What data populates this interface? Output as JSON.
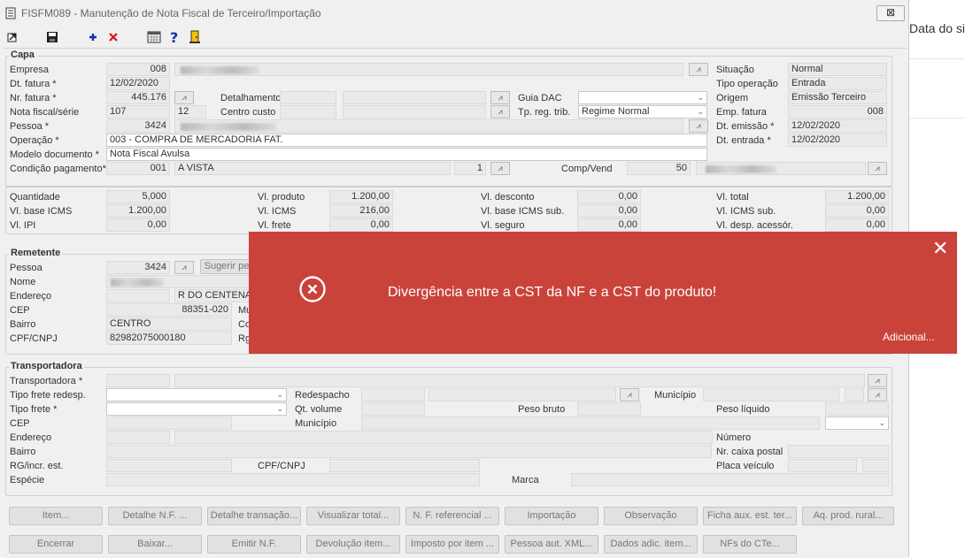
{
  "window": {
    "title": "FISFM089 - Manutenção de Nota Fiscal de Terceiro/Importação",
    "close_glyph": "⊠"
  },
  "toolbar": {
    "icons": [
      "exit-icon",
      "save-icon",
      "add-icon",
      "delete-icon",
      "calendar-icon",
      "help-icon",
      "door-icon"
    ]
  },
  "background_page": {
    "text": "Data do si"
  },
  "capa": {
    "legend": "Capa",
    "empresa": {
      "label": "Empresa",
      "code": "008"
    },
    "dt_fatura": {
      "label": "Dt. fatura *",
      "value": "12/02/2020"
    },
    "nr_fatura": {
      "label": "Nr. fatura *",
      "value": "445.176"
    },
    "detalhamento": {
      "label": "Detalhamento"
    },
    "guia_dac": {
      "label": "Guia DAC",
      "value": ""
    },
    "nota_fiscal": {
      "label": "Nota fiscal/série",
      "number": "107",
      "serie": "12"
    },
    "centro_custo": {
      "label": "Centro custo"
    },
    "tp_reg_trib": {
      "label": "Tp. reg. trib.",
      "value": "Regime Normal"
    },
    "pessoa": {
      "label": "Pessoa *",
      "code": "3424"
    },
    "operacao": {
      "label": "Operação *",
      "value": "003 - COMPRA DE MERCADORIA FAT."
    },
    "modelo": {
      "label": "Modelo documento *",
      "value": "Nota Fiscal Avulsa"
    },
    "condicao": {
      "label": "Condição pagamento*",
      "code": "001",
      "desc": "A VISTA",
      "parcelas": "1"
    },
    "comp_vend": {
      "label": "Comp/Vend",
      "code": "50"
    },
    "situacao": {
      "label": "Situação",
      "value": "Normal"
    },
    "tipo_operacao": {
      "label": "Tipo operação",
      "value": "Entrada"
    },
    "origem": {
      "label": "Origem",
      "value": "Emissão Terceiro"
    },
    "emp_fatura": {
      "label": "Emp. fatura",
      "value": "008"
    },
    "dt_emissao": {
      "label": "Dt. emissão *",
      "value": "12/02/2020"
    },
    "dt_entrada": {
      "label": "Dt. entrada *",
      "value": "12/02/2020"
    }
  },
  "totais": {
    "quantidade": {
      "label": "Quantidade",
      "value": "5,000"
    },
    "vl_base_icms": {
      "label": "Vl. base ICMS",
      "value": "1.200,00"
    },
    "vl_ipi": {
      "label": "Vl. IPI",
      "value": "0,00"
    },
    "vl_produto": {
      "label": "Vl. produto",
      "value": "1.200,00"
    },
    "vl_icms": {
      "label": "Vl. ICMS",
      "value": "216,00"
    },
    "vl_frete": {
      "label": "Vl. frete",
      "value": "0,00"
    },
    "vl_desconto": {
      "label": "Vl. desconto",
      "value": "0,00"
    },
    "vl_base_icms_sub": {
      "label": "Vl. base ICMS sub.",
      "value": "0,00"
    },
    "vl_seguro": {
      "label": "Vl. seguro",
      "value": "0,00"
    },
    "vl_total": {
      "label": "Vl. total",
      "value": "1.200,00"
    },
    "vl_icms_sub": {
      "label": "Vl. ICMS sub.",
      "value": "0,00"
    },
    "vl_desp_acessor": {
      "label": "Vl. desp. acessór.",
      "value": "0,00"
    }
  },
  "remetente": {
    "legend": "Remetente",
    "pessoa": {
      "label": "Pessoa",
      "code": "3424"
    },
    "sugerir_button": "Sugerir pe",
    "nome": {
      "label": "Nome"
    },
    "endereco": {
      "label": "Endereço",
      "value": "R DO CENTENAR"
    },
    "cep": {
      "label": "CEP",
      "value": "88351-020"
    },
    "bairro": {
      "label": "Bairro",
      "value": "CENTRO"
    },
    "cpf_cnpj": {
      "label": "CPF/CNPJ",
      "value": "82982075000180"
    },
    "mu_label": "Mu",
    "co_label": "Co",
    "rg_label": "Rg"
  },
  "transportadora": {
    "legend": "Transportadora",
    "transportadora": {
      "label": "Transportadora *"
    },
    "tipo_frete_redesp": {
      "label": "Tipo frete redesp.",
      "value": ""
    },
    "redespacho": {
      "label": "Redespacho"
    },
    "municipio1": {
      "label": "Município"
    },
    "tipo_frete": {
      "label": "Tipo frete *",
      "value": ""
    },
    "qt_volume": {
      "label": "Qt. volume"
    },
    "peso_bruto": {
      "label": "Peso bruto"
    },
    "peso_liquido": {
      "label": "Peso líquido"
    },
    "cep": {
      "label": "CEP"
    },
    "municipio2": {
      "label": "Município"
    },
    "endereco": {
      "label": "Endereço"
    },
    "numero": {
      "label": "Número"
    },
    "bairro": {
      "label": "Bairro"
    },
    "nr_caixa_postal": {
      "label": "Nr. caixa postal"
    },
    "rg_incr": {
      "label": "RG/incr. est."
    },
    "cpf_cnpj": {
      "label": "CPF/CNPJ"
    },
    "placa": {
      "label": "Placa veículo"
    },
    "especie": {
      "label": "Espécie"
    },
    "marca": {
      "label": "Marca"
    }
  },
  "buttons_row1": [
    "Item...",
    "Detalhe N.F. ...",
    "Detalhe transação...",
    "Visualizar total...",
    "N. F. referencial ...",
    "Importação",
    "Observação",
    "Ficha aux. est. ter...",
    "Aq. prod. rural..."
  ],
  "buttons_row2": [
    "Encerrar",
    "Baixar...",
    "Emitir N.F.",
    "Devolução item...",
    "Imposto por item ...",
    "Pessoa aut. XML...",
    "Dados adic. item...",
    "NFs do CTe..."
  ],
  "toast": {
    "message": "Divergência entre a CST da NF e a CST do produto!",
    "more": "Adicional...",
    "close": "✕",
    "background": "#c9433b"
  }
}
